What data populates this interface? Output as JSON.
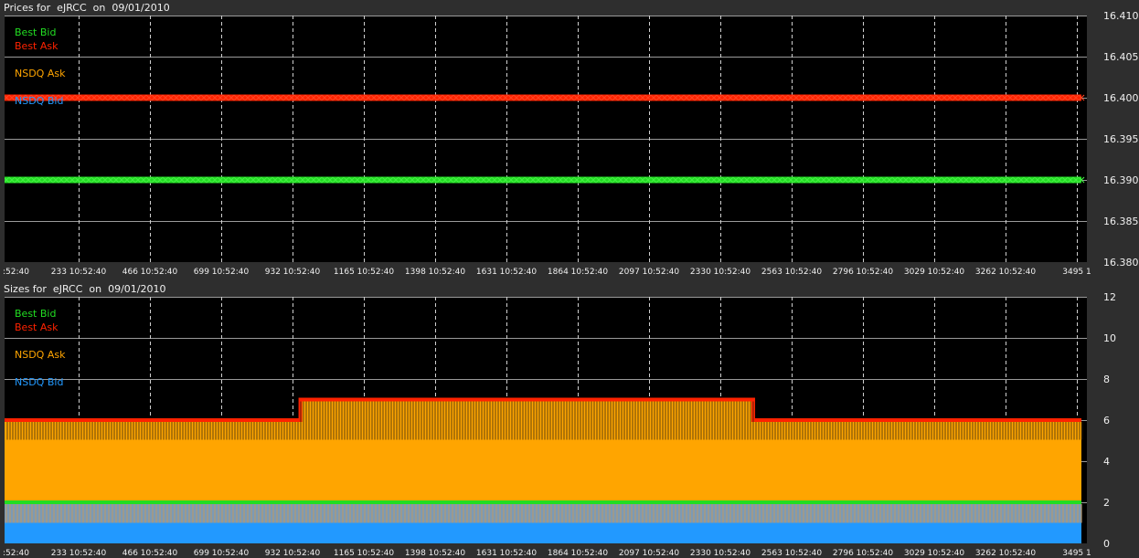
{
  "colors": {
    "best_bid": "#22dd22",
    "best_ask": "#ff2200",
    "nsdq_ask": "#ffa500",
    "nsdq_bid": "#2299ff",
    "grid": "#9a9a9a",
    "plot_bg": "#000000",
    "frame_bg": "#2e2e2e",
    "text": "#f0f0f0"
  },
  "legend": {
    "best_bid": "Best Bid",
    "best_ask": "Best Ask",
    "nsdq_ask": "NSDQ Ask",
    "nsdq_bid": "NSDQ Bid"
  },
  "x_ticks": [
    ":52:40",
    "233 10:52:40",
    "466 10:52:40",
    "699 10:52:40",
    "932 10:52:40",
    "1165 10:52:40",
    "1398 10:52:40",
    "1631 10:52:40",
    "1864 10:52:40",
    "2097 10:52:40",
    "2330 10:52:40",
    "2563 10:52:40",
    "2796 10:52:40",
    "3029 10:52:40",
    "3262 10:52:40",
    "3495 1"
  ],
  "chart_data": [
    {
      "type": "line",
      "title": "Prices for  eJRCC  on  09/01/2010",
      "xlabel": "",
      "ylabel": "",
      "x_range": [
        0,
        3495
      ],
      "ylim": [
        16.38,
        16.41
      ],
      "y_ticks": [
        "16.410",
        "16.405",
        "16.400",
        "16.395",
        "16.390",
        "16.385",
        "16.380"
      ],
      "y_tick_values": [
        16.41,
        16.405,
        16.4,
        16.395,
        16.39,
        16.385,
        16.38
      ],
      "grid": true,
      "legend_position": "top-left",
      "series": [
        {
          "name": "Best Bid",
          "key": "best_bid",
          "x": [
            0,
            3495
          ],
          "y": [
            16.39,
            16.39
          ]
        },
        {
          "name": "Best Ask",
          "key": "best_ask",
          "x": [
            0,
            3495
          ],
          "y": [
            16.4,
            16.4
          ]
        },
        {
          "name": "NSDQ Ask",
          "key": "nsdq_ask",
          "x": [
            0,
            3495
          ],
          "y": [
            16.4,
            16.4
          ]
        },
        {
          "name": "NSDQ Bid",
          "key": "nsdq_bid",
          "x": [
            0,
            3495
          ],
          "y": [
            16.39,
            16.39
          ]
        }
      ]
    },
    {
      "type": "area",
      "title": "Sizes for  eJRCC  on  09/01/2010",
      "xlabel": "",
      "ylabel": "",
      "x_range": [
        0,
        3495
      ],
      "ylim": [
        0,
        12
      ],
      "y_ticks": [
        "12",
        "10",
        "8",
        "6",
        "4",
        "2",
        "0"
      ],
      "y_tick_values": [
        12,
        10,
        8,
        6,
        4,
        2,
        0
      ],
      "grid": true,
      "legend_position": "top-left",
      "series": [
        {
          "name": "NSDQ Ask",
          "key": "nsdq_ask",
          "x": [
            0,
            3495
          ],
          "y": [
            5,
            5
          ]
        },
        {
          "name": "NSDQ Bid",
          "key": "nsdq_bid",
          "x": [
            0,
            3495
          ],
          "y": [
            1,
            1
          ]
        },
        {
          "name": "Best Ask",
          "key": "best_ask",
          "x": [
            0,
            960,
            960,
            2430,
            2430,
            3495
          ],
          "y": [
            6,
            6,
            7,
            7,
            6,
            6
          ]
        },
        {
          "name": "Best Bid",
          "key": "best_bid",
          "x": [
            0,
            3495
          ],
          "y": [
            2,
            2
          ]
        }
      ]
    }
  ]
}
